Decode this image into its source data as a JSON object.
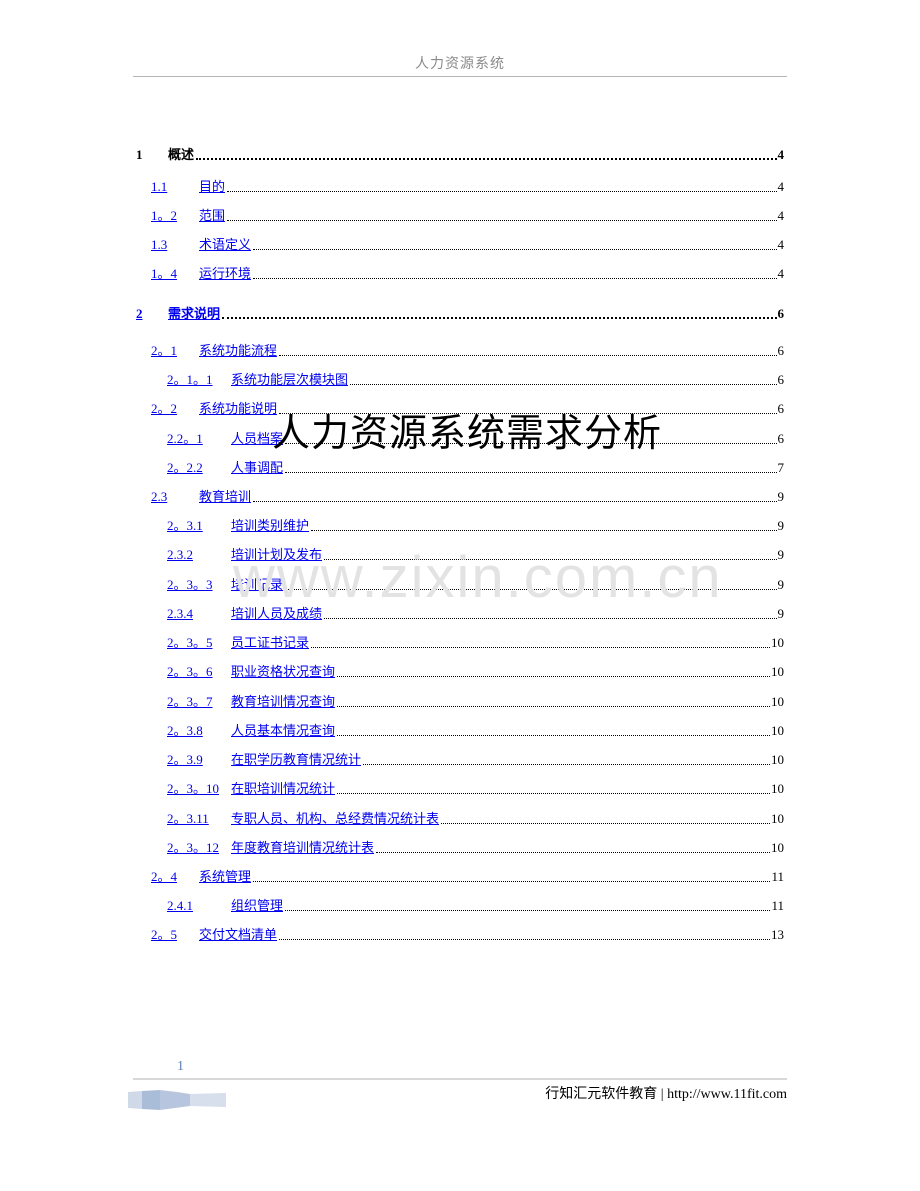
{
  "header": {
    "title": "人力资源系统"
  },
  "overlay_title": "人力资源系统需求分析",
  "watermark": "www.zixin.com.cn",
  "toc": [
    {
      "num": "1",
      "title": "概述",
      "page": "4",
      "level": 0,
      "linked": false
    },
    {
      "num": "1.1",
      "title": "目的",
      "page": "4",
      "level": 1,
      "linked": true
    },
    {
      "num": "1。2",
      "title": "范围",
      "page": "4",
      "level": 1,
      "linked": true
    },
    {
      "num": "1.3",
      "title": "术语定义",
      "page": "4",
      "level": 1,
      "linked": true
    },
    {
      "num": "1。4",
      "title": "运行环境",
      "page": "4",
      "level": 1,
      "linked": true
    },
    {
      "num": "2",
      "title": "需求说明",
      "page": "6",
      "level": 0,
      "linked": true
    },
    {
      "num": "2。1",
      "title": "系统功能流程",
      "page": "6",
      "level": 1,
      "linked": true
    },
    {
      "num": "2。1。1",
      "title": "系统功能层次模块图",
      "page": "6",
      "level": 2,
      "linked": true
    },
    {
      "num": "2。2",
      "title": "系统功能说明",
      "page": "6",
      "level": 1,
      "linked": true
    },
    {
      "num": "2.2。1",
      "title": "人员档案",
      "page": "6",
      "level": 2,
      "linked": true
    },
    {
      "num": "2。2.2",
      "title": "人事调配",
      "page": "7",
      "level": 2,
      "linked": true
    },
    {
      "num": "2.3",
      "title": "教育培训",
      "page": "9",
      "level": 1,
      "linked": true
    },
    {
      "num": "2。3.1",
      "title": "培训类别维护",
      "page": "9",
      "level": 2,
      "linked": true
    },
    {
      "num": "2.3.2",
      "title": "培训计划及发布",
      "page": "9",
      "level": 2,
      "linked": true
    },
    {
      "num": "2。3。3",
      "title": "培训记录",
      "page": "9",
      "level": 2,
      "linked": true
    },
    {
      "num": "2.3.4",
      "title": "培训人员及成绩",
      "page": "9",
      "level": 2,
      "linked": true
    },
    {
      "num": "2。3。5",
      "title": "员工证书记录",
      "page": "10",
      "level": 2,
      "linked": true
    },
    {
      "num": "2。3。6",
      "title": "职业资格状况查询",
      "page": "10",
      "level": 2,
      "linked": true
    },
    {
      "num": "2。3。7",
      "title": "教育培训情况查询",
      "page": "10",
      "level": 2,
      "linked": true
    },
    {
      "num": "2。3.8",
      "title": "人员基本情况查询",
      "page": "10",
      "level": 2,
      "linked": true
    },
    {
      "num": "2。3.9",
      "title": "在职学历教育情况统计",
      "page": "10",
      "level": 2,
      "linked": true
    },
    {
      "num": "2。3。10",
      "title": "在职培训情况统计",
      "page": "10",
      "level": 2,
      "linked": true
    },
    {
      "num": "2。3.11",
      "title": "专职人员、机构、总经费情况统计表",
      "page": "10",
      "level": 2,
      "linked": true
    },
    {
      "num": "2。3。12",
      "title": "年度教育培训情况统计表",
      "page": "10",
      "level": 2,
      "linked": true
    },
    {
      "num": "2。4",
      "title": "系统管理",
      "page": "11",
      "level": 1,
      "linked": true
    },
    {
      "num": "2.4.1",
      "title": "组织管理",
      "page": "11",
      "level": 2,
      "linked": true
    },
    {
      "num": "2。5",
      "title": "交付文档清单",
      "page": "13",
      "level": 1,
      "linked": true
    }
  ],
  "footer": {
    "page_number": "1",
    "text": "行知汇元软件教育 | http://www.11fit.com"
  }
}
